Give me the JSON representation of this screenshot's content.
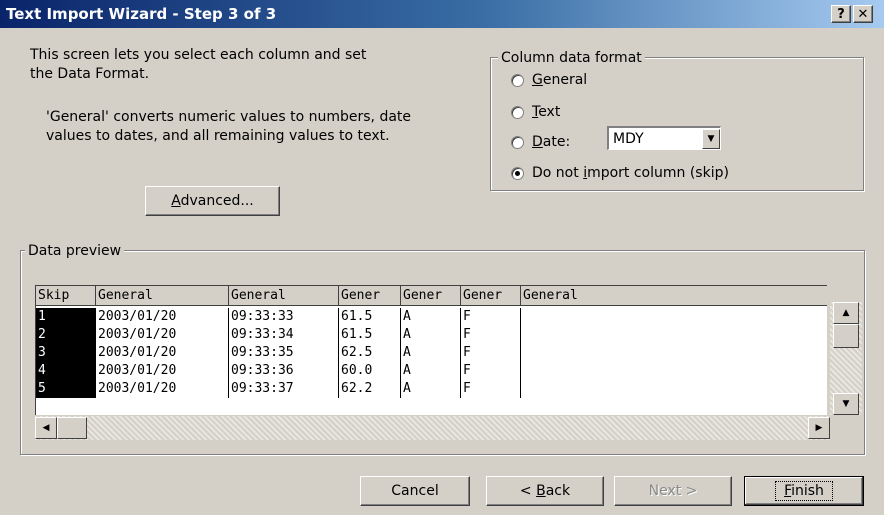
{
  "window": {
    "title": "Text Import Wizard - Step 3 of 3",
    "help_label": "?",
    "close_label": "✕"
  },
  "intro": {
    "line1": "This screen lets you select each column and set",
    "line2": "the Data Format.",
    "line3": "'General' converts numeric values to numbers, date",
    "line4": "values to dates, and all remaining values to text."
  },
  "advanced_button": {
    "label": "Advanced..."
  },
  "column_format": {
    "legend": "Column data format",
    "options": [
      {
        "label": "General",
        "selected": false
      },
      {
        "label": "Text",
        "selected": false
      },
      {
        "label": "Date:",
        "selected": false
      },
      {
        "label": "Do not import column (skip)",
        "selected": true
      }
    ],
    "date_value": "MDY"
  },
  "preview": {
    "legend": "Data preview",
    "headers": [
      "Skip",
      "General",
      "General",
      "Gener",
      "Gener",
      "Gener",
      "General"
    ],
    "rows": [
      [
        "1",
        "2003/01/20",
        "09:33:33",
        "61.5",
        "A",
        "F",
        ""
      ],
      [
        "2",
        "2003/01/20",
        "09:33:34",
        "61.5",
        "A",
        "F",
        ""
      ],
      [
        "3",
        "2003/01/20",
        "09:33:35",
        "62.5",
        "A",
        "F",
        ""
      ],
      [
        "4",
        "2003/01/20",
        "09:33:36",
        "60.0",
        "A",
        "F",
        ""
      ],
      [
        "5",
        "2003/01/20",
        "09:33:37",
        "62.2",
        "A",
        "F",
        ""
      ]
    ]
  },
  "footer": {
    "cancel": "Cancel",
    "back": "< Back",
    "next": "Next >",
    "finish": "Finish"
  }
}
